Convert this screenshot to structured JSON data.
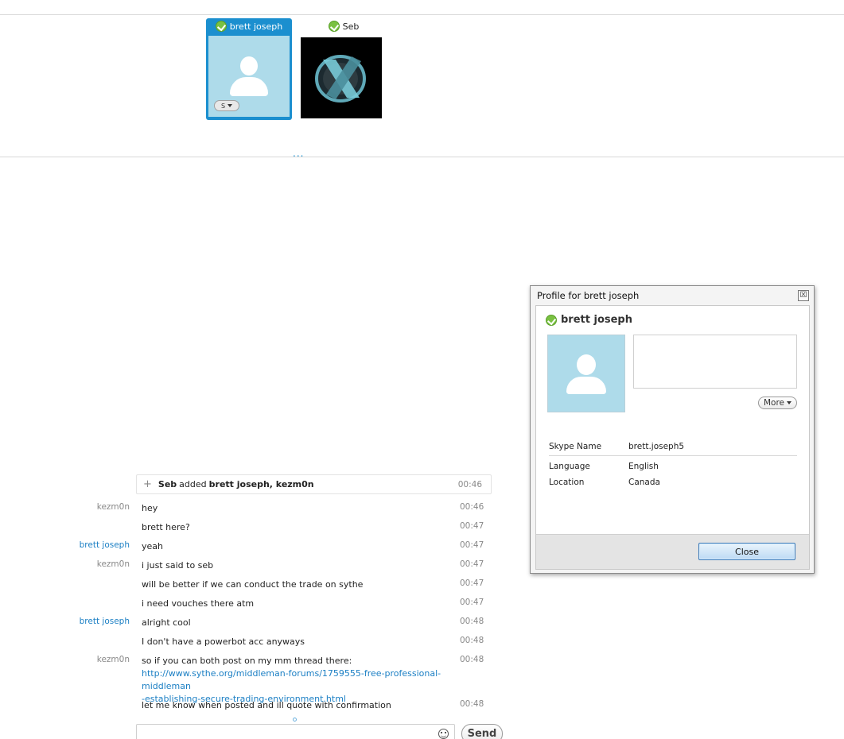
{
  "participants": [
    {
      "name": "brett joseph",
      "selected": true,
      "call_button_label": "S"
    },
    {
      "name": "Seb",
      "selected": false
    }
  ],
  "more_participants_label": "...",
  "chat": {
    "system_message": {
      "actor": "Seb",
      "verb": "added",
      "targets": "brett joseph, kezm0n",
      "time": "00:46"
    },
    "messages": [
      {
        "author": "kezm0n",
        "author_style": "gray",
        "text": "hey",
        "time": "00:46"
      },
      {
        "author": "",
        "text": "brett here?",
        "time": "00:47"
      },
      {
        "author": "brett joseph",
        "author_style": "blue",
        "text": "yeah",
        "time": "00:47"
      },
      {
        "author": "kezm0n",
        "author_style": "gray",
        "text": "i just said to seb",
        "time": "00:47"
      },
      {
        "author": "",
        "text": "will be better if we can conduct the trade on sythe",
        "time": "00:47"
      },
      {
        "author": "",
        "text": "i need vouches there atm",
        "time": "00:47"
      },
      {
        "author": "brett joseph",
        "author_style": "blue",
        "text": "alright cool",
        "time": "00:48"
      },
      {
        "author": "",
        "text": "I don't have a powerbot acc anyways",
        "time": "00:48"
      },
      {
        "author": "kezm0n",
        "author_style": "gray",
        "text": "so if you can both post on my mm thread there:",
        "link_line1": "http://www.sythe.org/middleman-forums/1759555-free-professional-middleman",
        "link_line2": "-establishing-secure-trading-environment.html",
        "time": "00:48"
      },
      {
        "author": "",
        "text": "let me know when posted and ill quote with confirmation",
        "time": "00:48"
      }
    ],
    "input_value": "",
    "send_label": "Send"
  },
  "profile_dialog": {
    "title": "Profile for brett joseph",
    "close_x_label": "☒",
    "display_name": "brett joseph",
    "more_label": "More",
    "fields": [
      {
        "label": "Skype Name",
        "value": "brett.joseph5"
      },
      {
        "label": "Language",
        "value": "English"
      },
      {
        "label": "Location",
        "value": "Canada"
      }
    ],
    "close_label": "Close"
  },
  "colors": {
    "accent": "#1b8fcf",
    "online": "#7ac142",
    "avatar_bg": "#aedbea",
    "link": "#1b7fc4"
  },
  "icons": [
    "online-status-icon",
    "avatar-silhouette-icon",
    "skype-call-icon",
    "add-icon",
    "emoji-icon",
    "close-icon",
    "chevron-down-icon"
  ]
}
